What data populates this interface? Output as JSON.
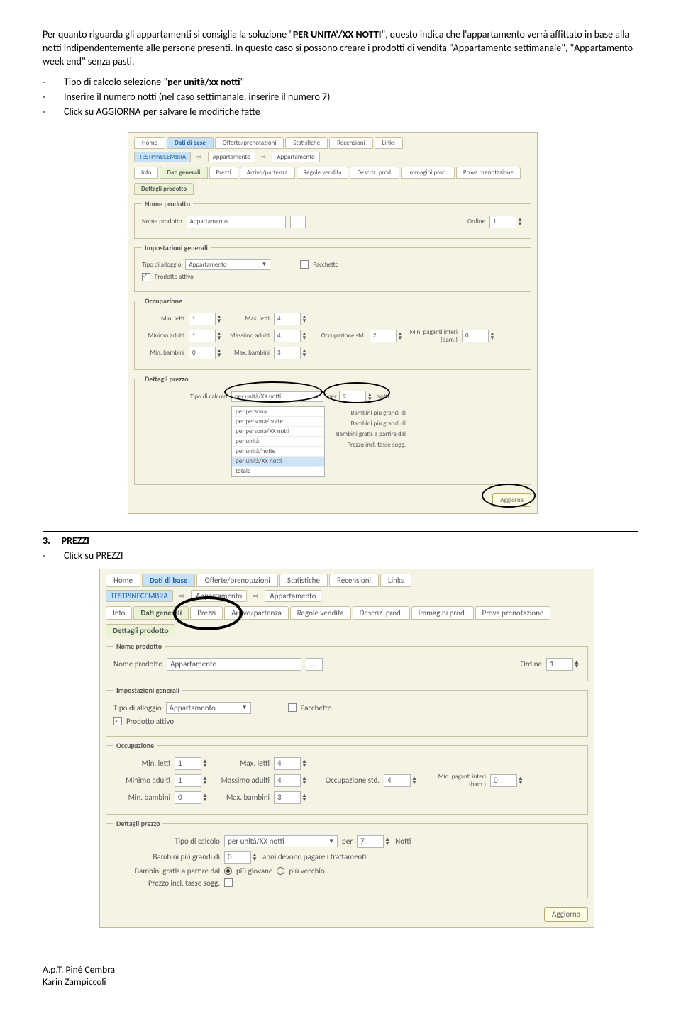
{
  "intro": {
    "p1a": "Per quanto riguarda gli appartamenti si consiglia la soluzione \"",
    "p1b": "PER UNITA'/XX NOTTI",
    "p1c": "\", questo indica che l'appartamento verrà affittato in base alla notti indipendentemente alle persone presenti. In questo caso si possono creare i prodotti di vendita \"Appartamento settimanale\", \"Appartamento week end\" senza pasti."
  },
  "bullets": {
    "b1a": "Tipo di calcolo selezione \"",
    "b1b": "per unità/xx notti",
    "b1c": "\"",
    "b2": "Inserire il numero notti (nel caso settimanale, inserire il numero 7)",
    "b3": "Click su AGGIORNA per salvare le modifiche fatte"
  },
  "section3": {
    "num": "3.",
    "title": "PREZZI",
    "bullet": "Click su PREZZI"
  },
  "ui": {
    "topTabs": [
      "Home",
      "Dati di base",
      "Offerte/prenotazioni",
      "Statistiche",
      "Recensioni",
      "Links"
    ],
    "bcRoot": "TESTPINECEMBRA",
    "bcApp": "Appartamento",
    "subTabs": [
      "Info",
      "Dati generali",
      "Prezzi",
      "Arrivo/partenza",
      "Regole vendita",
      "Descriz. prod.",
      "Immagini prod.",
      "Prova prenotazione"
    ],
    "dettagliProdotto": "Dettagli prodotto",
    "nomeProdottoLegend": "Nome prodotto",
    "nomeProdottoLbl": "Nome prodotto",
    "nomeProdottoVal": "Appartamento",
    "ordineLbl": "Ordine",
    "ordineVal": "1",
    "impGenLegend": "Impostazioni generali",
    "tipoAlloggioLbl": "Tipo di alloggio",
    "tipoAlloggioVal": "Appartamento",
    "prodAttivo": "Prodotto attivo",
    "pacchetto": "Pacchetto",
    "occLegend": "Occupazione",
    "minLetti": "Min. letti",
    "minLettiV": "1",
    "maxLetti": "Max. letti",
    "maxLettiV": "4",
    "minAdulti": "Minimo adulti",
    "minAdultiV": "1",
    "maxAdulti": "Massimo adulti",
    "maxAdultiV": "4",
    "occStd": "Occupazione std.",
    "occStdV1": "2",
    "occStdV2": "4",
    "minPag": "Min. paganti interi (bam.)",
    "minPagV": "0",
    "minBamb": "Min. bambini",
    "minBambV": "0",
    "maxBamb": "Max. bambini",
    "maxBambV": "3",
    "detPrezzoLegend": "Dettagli prezzo",
    "tipoCalcolo": "Tipo di calcolo",
    "tipoCalcoloVal": "per unità/XX notti",
    "per": "per",
    "notti": "Notti",
    "nottiV1": "2",
    "nottiV2": "7",
    "bambGrandi": "Bambini più grandi di",
    "bambGrandiV": "0",
    "bambGrandiSuffix": "anni devono pagare i trattamenti",
    "bambGratis": "Bambini gratis a partire dal",
    "piuGiovane": "più giovane",
    "piuVecchio": "più vecchio",
    "prezzoIncl": "Prezzo incl. tasse sogg.",
    "aggiorna": "Aggiorna",
    "ddOptions": [
      "per persona",
      "per persona/notte",
      "per persona/XX notti",
      "per unità",
      "per unità/notte",
      "per unità/XX notti",
      "totale"
    ]
  },
  "footer": {
    "l1": "A.p.T. Piné Cembra",
    "l2": "Karin Zampiccoli"
  }
}
